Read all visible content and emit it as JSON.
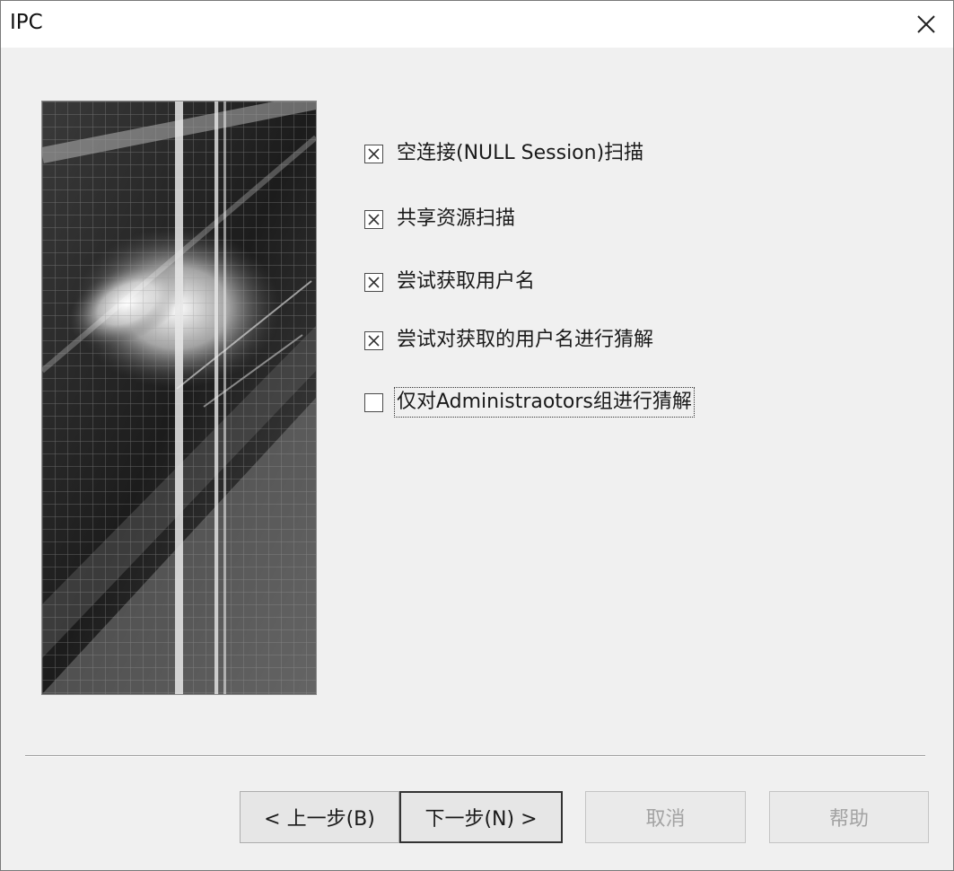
{
  "window": {
    "title": "IPC"
  },
  "icons": {
    "close": "close-icon",
    "checkbox_checked": "checkbox-checked-icon"
  },
  "options": [
    {
      "label": "空连接(NULL Session)扫描",
      "checked": true
    },
    {
      "label": "共享资源扫描",
      "checked": true
    },
    {
      "label": "尝试获取用户名",
      "checked": true
    },
    {
      "label": "尝试对获取的用户名进行猜解",
      "checked": true
    },
    {
      "label": "仅对Administraotors组进行猜解",
      "checked": false,
      "focused": true
    }
  ],
  "buttons": {
    "back": "< 上一步(B)",
    "next": "下一步(N) >",
    "cancel": "取消",
    "help": "帮助"
  },
  "button_states": {
    "back": "enabled",
    "next": "default",
    "cancel": "disabled",
    "help": "disabled"
  },
  "colors": {
    "window_bg": "#f0f0f0",
    "titlebar_bg": "#ffffff",
    "disabled_text": "#a3a3a3"
  }
}
